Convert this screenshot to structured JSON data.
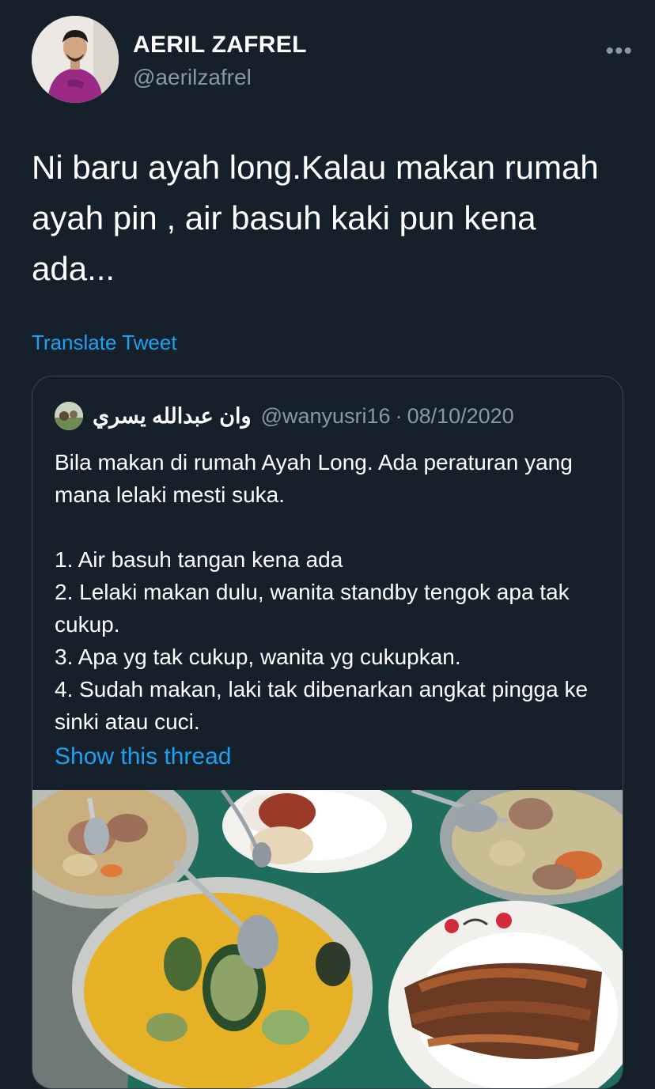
{
  "tweet": {
    "author_name": "AERIL ZAFREL",
    "author_handle": "@aerilzafrel",
    "more_icon": "more-icon",
    "text": "Ni baru ayah long.Kalau makan rumah ayah pin , air basuh kaki pun kena ada...",
    "translate_label": "Translate Tweet"
  },
  "quoted": {
    "author_name": "وان عبدالله يسري",
    "author_handle": "@wanyusri16",
    "separator": "·",
    "date": "08/10/2020",
    "body": "Bila makan di rumah Ayah Long. Ada peraturan yang mana lelaki mesti suka.\n\n1. Air basuh tangan kena ada\n2. Lelaki makan dulu, wanita standby tengok apa tak cukup.\n3. Apa yg tak cukup, wanita yg cukupkan.\n4. Sudah makan, laki tak dibenarkan angkat pingga ke sinki atau cuci.",
    "show_thread_label": "Show this thread"
  },
  "colors": {
    "background": "#15202b",
    "link": "#1da1f2",
    "secondary_text": "#8899a6",
    "border": "#38444d"
  }
}
